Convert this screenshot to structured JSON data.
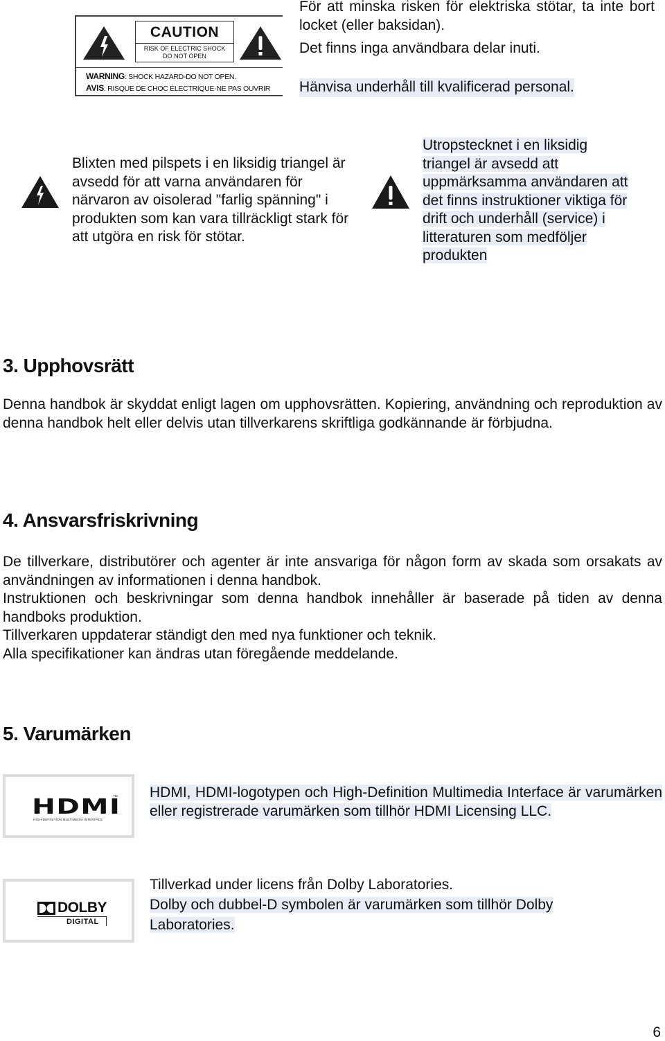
{
  "caution_label": {
    "title": "CAUTION",
    "subtitle_line1": "RISK OF ELECTRIC SHOCK",
    "subtitle_line2": "DO NOT OPEN",
    "warning_key": "WARNING",
    "warning_text": ": SHOCK HAZARD-DO NOT OPEN.",
    "avis_key": "AVIS",
    "avis_text": ": RISQUE DE CHOC ÉLECTRIQUE-NE PAS OUVRIR",
    "left_icon": "lightning-triangle-icon",
    "right_icon": "exclamation-triangle-icon"
  },
  "intro": {
    "para1": "För att minska risken för elektriska stötar, ta inte bort locket (eller baksidan).",
    "para1b": "Det finns inga användbara delar inuti.",
    "para2": "Hänvisa underhåll till kvalificerad personal."
  },
  "symbols": {
    "lightning": {
      "icon": "lightning-triangle-icon",
      "text": "Blixten med pilspets i en liksidig triangel är avsedd för att varna användaren för närvaron av oisolerad \"farlig spänning\" i produkten som kan vara tillräckligt stark för att utgöra en risk för stötar."
    },
    "exclamation": {
      "icon": "exclamation-triangle-icon",
      "lines": [
        "Utropstecknet i en liksidig",
        "triangel är avsedd att",
        "uppmärksamma användaren att",
        "det finns instruktioner viktiga för",
        "drift och underhåll (service) i",
        "litteraturen som medföljer",
        "produkten"
      ]
    }
  },
  "sections": {
    "copyright": {
      "heading": "3. Upphovsrätt",
      "text": "Denna handbok är skyddat enligt lagen om upphovsrätten. Kopiering, användning och reproduktion av denna handbok helt eller delvis utan tillverkarens skriftliga godkännande är förbjudna."
    },
    "disclaimer": {
      "heading": "4. Ansvarsfriskrivning",
      "para1": "De tillverkare, distributörer och agenter är inte ansvariga för någon form av skada som orsakats av användningen av informationen i denna handbok.",
      "para2": "Instruktionen och beskrivningar som denna handbok innehåller är baserade på tiden av denna handboks produktion.",
      "para3": "Tillverkaren uppdaterar ständigt den med nya funktioner och teknik.",
      "para3b": "Alla specifikationer kan ändras utan föregående meddelande."
    },
    "trademarks": {
      "heading": "5. Varumärken",
      "hdmi": {
        "logo_text": "HDMI",
        "logo_tm": "™",
        "logo_sub": "HIGH-DEFINITION MULTIMEDIA INTERFACE",
        "text": "HDMI, HDMI-logotypen och High-Definition Multimedia Interface är varumärken eller registrerade varumärken som tillhör HDMI Licensing LLC."
      },
      "dolby": {
        "logo_text": "DOLBY",
        "logo_sub": "DIGITAL",
        "line1": "Tillverkad under licens från Dolby Laboratories.",
        "line2": "Dolby och dubbel-D symbolen är varumärken som tillhör Dolby",
        "line3": "Laboratories."
      }
    }
  },
  "footer": {
    "page_number": "6"
  },
  "colors": {
    "highlight": "#e8ecf6",
    "text": "#111111"
  }
}
